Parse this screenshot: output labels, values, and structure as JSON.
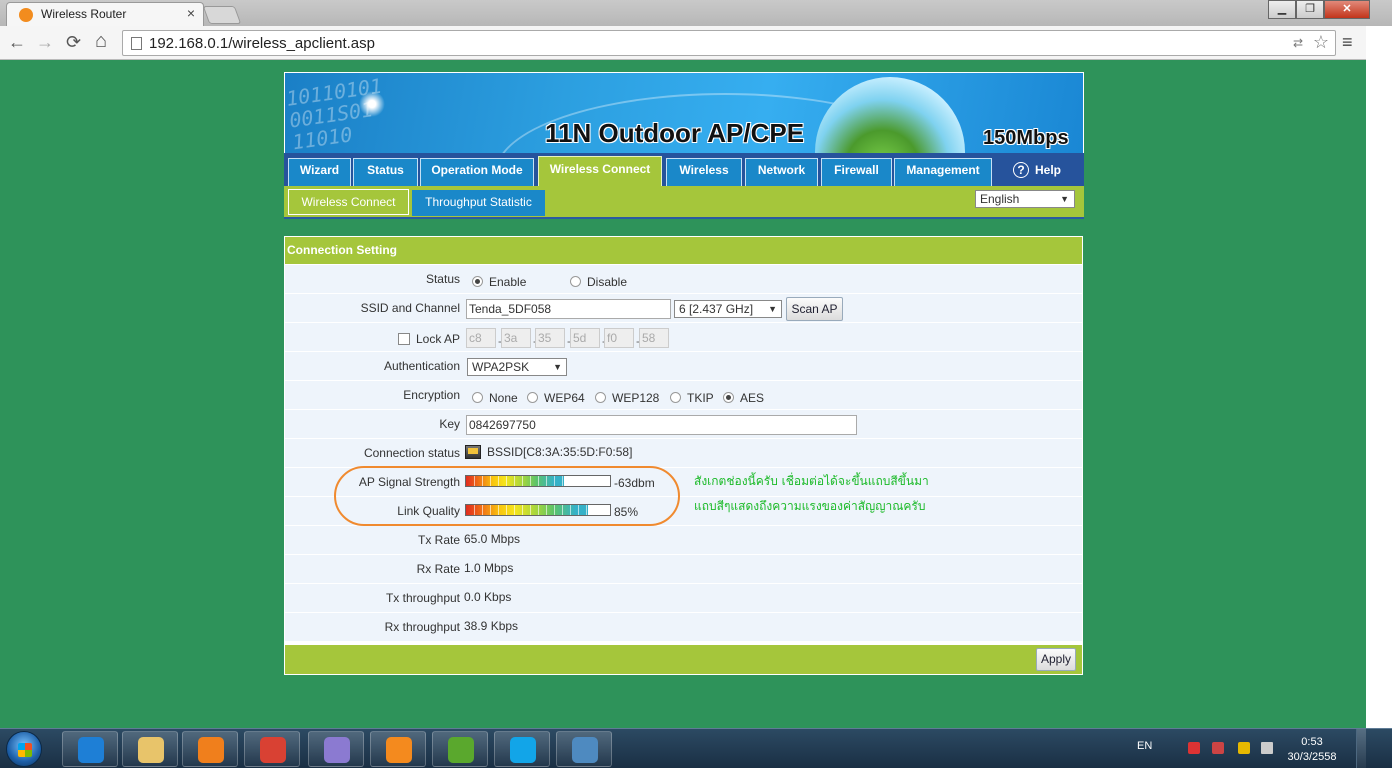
{
  "browser": {
    "tab_title": "Wireless Router",
    "tab_close": "×",
    "url": "192.168.0.1/wireless_apclient.asp",
    "back_icon": "←",
    "forward_icon": "→",
    "reload_icon": "⟳",
    "home_icon": "⌂",
    "star_icon": "☆",
    "translate_icon": "⇄",
    "menu_icon": "≡",
    "window_min": "▁",
    "window_max": "❐",
    "window_close": "✕"
  },
  "banner": {
    "title": "11N Outdoor AP/CPE",
    "speed": "150Mbps",
    "digits": "10110101\n0011S01\n11010"
  },
  "nav": {
    "tabs": [
      {
        "label": "Wizard"
      },
      {
        "label": "Status"
      },
      {
        "label": "Operation Mode"
      },
      {
        "label": "Wireless Connect"
      },
      {
        "label": "Wireless"
      },
      {
        "label": "Network"
      },
      {
        "label": "Firewall"
      },
      {
        "label": "Management"
      }
    ],
    "help": "Help",
    "help_icon": "?"
  },
  "subnav": {
    "active": "Wireless Connect",
    "other": "Throughput Statistic",
    "language": "English",
    "arrow": "▼"
  },
  "panel": {
    "heading": "Connection Setting",
    "status": {
      "label": "Status",
      "enable": "Enable",
      "disable": "Disable",
      "selected": "Enable"
    },
    "ssid": {
      "label": "SSID and Channel",
      "value": "Tenda_5DF058",
      "channel": "6 [2.437 GHz]",
      "scan_button": "Scan AP"
    },
    "lock_ap": {
      "label": "Lock AP",
      "mac": [
        "c8",
        "3a",
        "35",
        "5d",
        "f0",
        "58"
      ],
      "sep": "-"
    },
    "authentication": {
      "label": "Authentication",
      "value": "WPA2PSK"
    },
    "encryption": {
      "label": "Encryption",
      "options": [
        "None",
        "WEP64",
        "WEP128",
        "TKIP",
        "AES"
      ],
      "selected": "AES"
    },
    "key": {
      "label": "Key",
      "value": "0842697750"
    },
    "connection_status": {
      "label": "Connection status",
      "value": "BSSID[C8:3A:35:5D:F0:58]"
    },
    "signal": {
      "label": "AP Signal Strength",
      "value": "-63dbm",
      "fraction": 0.68
    },
    "link_quality": {
      "label": "Link Quality",
      "value": "85%",
      "fraction": 0.85
    },
    "tx_rate": {
      "label": "Tx Rate",
      "value": "65.0 Mbps"
    },
    "rx_rate": {
      "label": "Rx Rate",
      "value": "1.0 Mbps"
    },
    "tx_throughput": {
      "label": "Tx throughput",
      "value": "0.0 Kbps"
    },
    "rx_throughput": {
      "label": "Rx throughput",
      "value": "38.9 Kbps"
    },
    "apply_button": "Apply"
  },
  "annotation": {
    "line1": "สังเกตช่องนี้ครับ เชื่อมต่อได้จะขึ้นแถบสีขึ้นมา",
    "line2": "แถบสีๆแสดงถึงความแรงของค่าสัญญาณครับ",
    "color": "#1cba29"
  },
  "taskbar": {
    "apps": [
      {
        "name": "internet-explorer",
        "color": "#1e7fd6"
      },
      {
        "name": "file-explorer",
        "color": "#e8c46a"
      },
      {
        "name": "media-player",
        "color": "#f07f1c"
      },
      {
        "name": "chrome",
        "color": "#d94133"
      },
      {
        "name": "paint",
        "color": "#8b7ad1"
      },
      {
        "name": "uc-browser",
        "color": "#f48a1e"
      },
      {
        "name": "utorrent",
        "color": "#5aa82d"
      },
      {
        "name": "skype",
        "color": "#12a5e8"
      },
      {
        "name": "remote-desktop",
        "color": "#4e8ac0"
      }
    ],
    "lang": "EN",
    "time": "0:53",
    "date": "30/3/2558"
  }
}
